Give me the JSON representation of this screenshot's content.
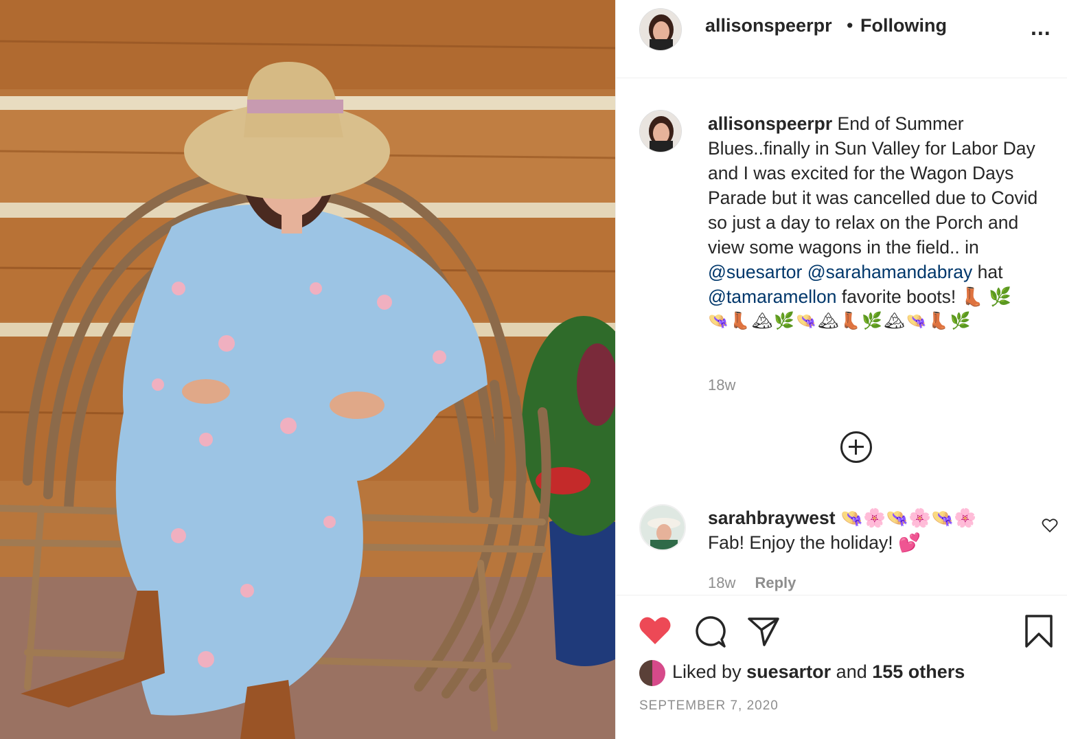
{
  "photo": {
    "alt_icon": "post-photo"
  },
  "header": {
    "username": "allisonspeerpr",
    "separator": "•",
    "follow_status": "Following",
    "more_icon": "more-options-icon",
    "more_label": "..."
  },
  "caption": {
    "username": "allisonspeerpr",
    "text_1": "End of Summer Blues..finally in Sun Valley for Labor Day and I was excited for the Wagon Days Parade but it was cancelled due to Covid so just a day to relax on the Porch and view some wagons in the field.. in",
    "mention_1": "@suesartor",
    "mention_2": "@sarahamandabray",
    "text_2": "hat",
    "mention_3": "@tamaramellon",
    "text_3": "favorite boots! 👢 🌿",
    "emojis": "👒👢🏔🌿👒🏔👢🌿🏔👒👢🌿",
    "time": "18w"
  },
  "load_more_icon": "plus-circle-icon",
  "comment": {
    "username": "sarahbraywest",
    "emojis": "👒🌸👒🌸👒🌸",
    "text": "Fab! Enjoy the holiday! 💕",
    "time": "18w",
    "reply_label": "Reply"
  },
  "actions": {
    "like_color": "#ed4956",
    "liked_by_prefix": "Liked by",
    "liked_by_user": "suesartor",
    "liked_by_and": "and",
    "liked_by_count": "155 others",
    "date": "SEPTEMBER 7, 2020"
  }
}
